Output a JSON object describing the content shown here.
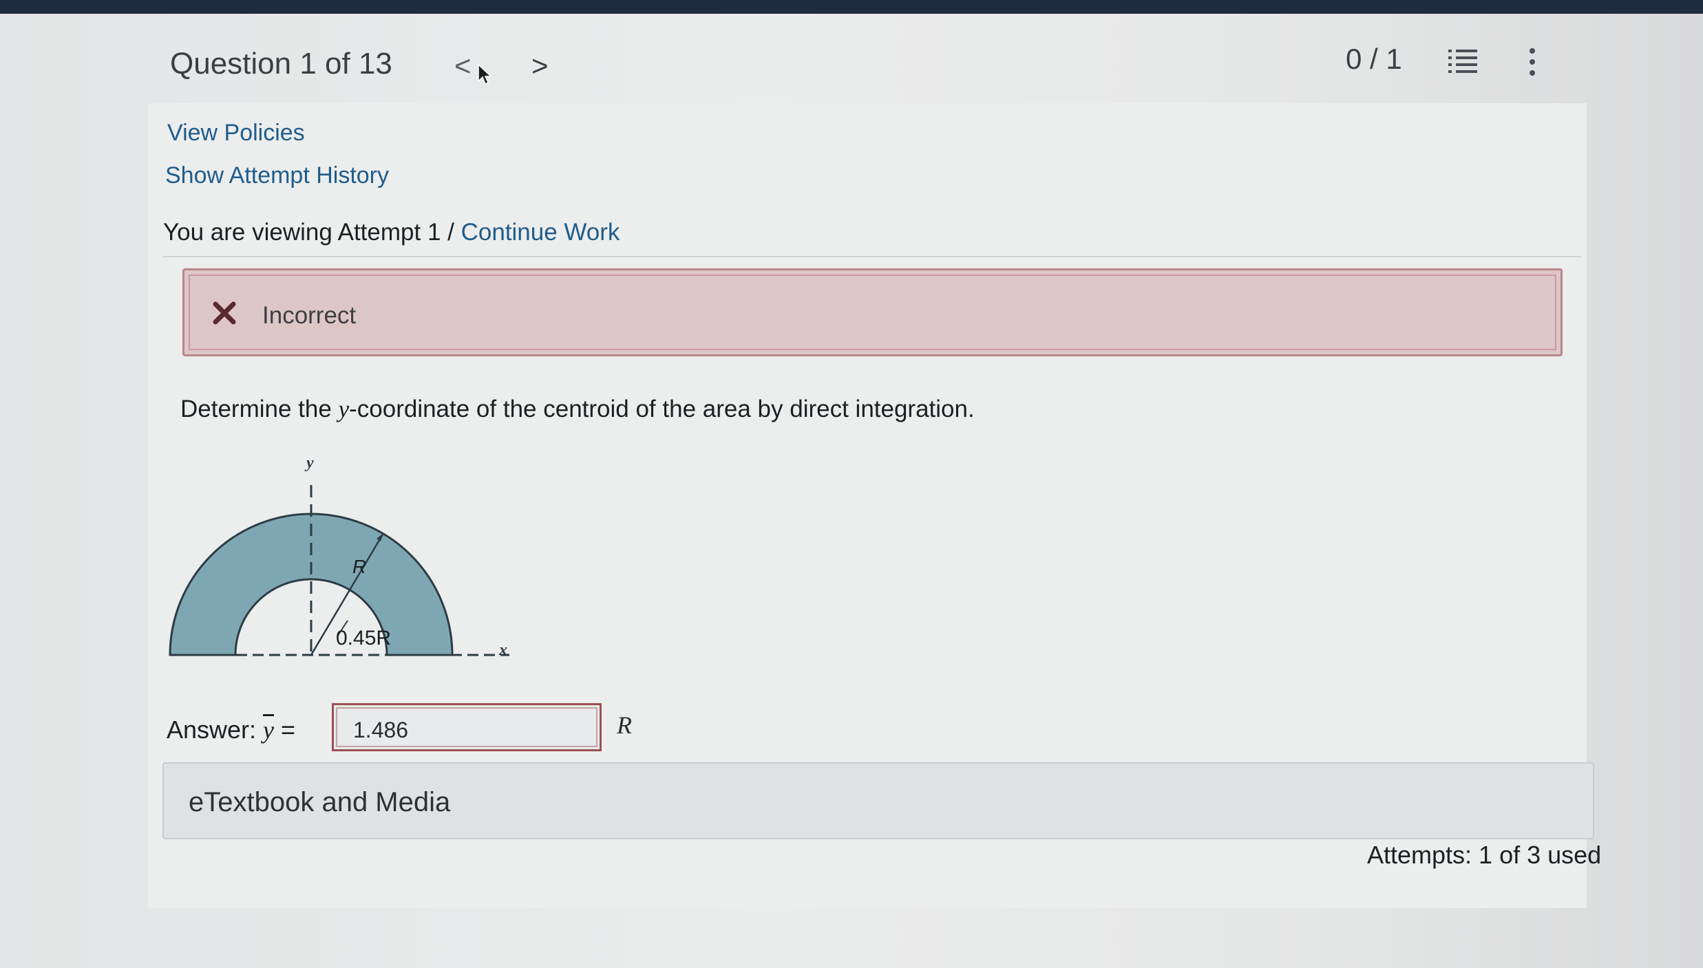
{
  "header": {
    "question_label": "Question 1 of 13",
    "prev_symbol": "<",
    "next_symbol": ">",
    "score": "0 / 1"
  },
  "links": {
    "view_policies": "View Policies",
    "show_attempt_history": "Show Attempt History"
  },
  "attempt": {
    "viewing_text": "You are viewing Attempt 1 / ",
    "continue_work": "Continue Work"
  },
  "feedback": {
    "status": "Incorrect",
    "status_color": "#b7878a"
  },
  "question": {
    "prefix": "Determine the ",
    "variable": "y",
    "suffix": "-coordinate of the centroid of the area by direct integration."
  },
  "figure": {
    "axis_y_label": "y",
    "axis_x_label": "x",
    "outer_radius_label": "R",
    "inner_radius_label": "0.45R",
    "fill_color": "#7ea7b3"
  },
  "answer": {
    "label_prefix": "Answer: ",
    "symbol": "y",
    "equals": " =",
    "value": "1.486",
    "unit": "R"
  },
  "etextbook_label": "eTextbook and Media",
  "attempts_text": "Attempts: 1 of 3 used"
}
